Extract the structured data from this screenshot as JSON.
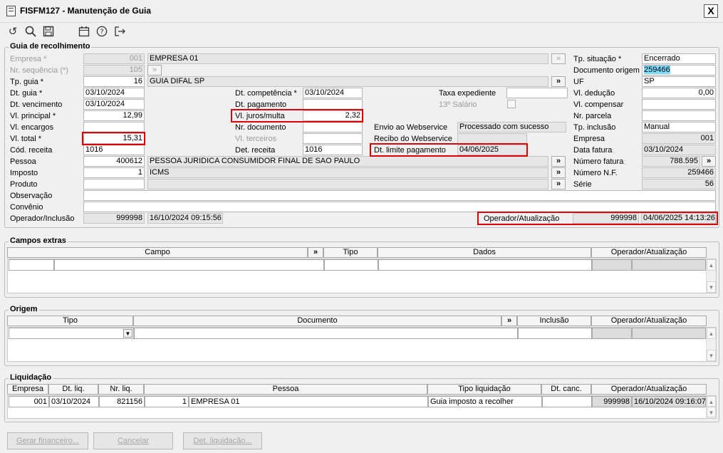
{
  "window": {
    "title": "FISFM127 - Manutenção de Guia",
    "close": "X"
  },
  "toolbar": {
    "icons": [
      "undo-icon",
      "search-icon",
      "save-icon",
      "calendar-icon",
      "help-icon",
      "exit-icon"
    ]
  },
  "guia": {
    "legend": "Guia de recolhimento",
    "empresa": {
      "label": "Empresa *",
      "code": "001",
      "name": "EMPRESA 01"
    },
    "nr_sequencia": {
      "label": "Nr. sequência (*)",
      "value": "105"
    },
    "tp_guia": {
      "label": "Tp. guia *",
      "code": "16",
      "name": "GUIA DIFAL SP"
    },
    "dt_guia": {
      "label": "Dt. guia *",
      "value": "03/10/2024"
    },
    "dt_vencimento": {
      "label": "Dt. vencimento",
      "value": "03/10/2024"
    },
    "vl_principal": {
      "label": "Vl. principal *",
      "value": "12,99"
    },
    "vl_encargos": {
      "label": "Vl. encargos",
      "value": ""
    },
    "vl_total": {
      "label": "Vl. total *",
      "value": "15,31"
    },
    "cod_receita": {
      "label": "Cód. receita",
      "value": "1016"
    },
    "pessoa": {
      "label": "Pessoa",
      "code": "400612",
      "name": "PESSOA JURIDICA CONSUMIDOR FINAL DE SAO PAULO"
    },
    "imposto": {
      "label": "Imposto",
      "code": "1",
      "name": "ICMS"
    },
    "produto": {
      "label": "Produto",
      "value": ""
    },
    "observacao": {
      "label": "Observação",
      "value": ""
    },
    "convenio": {
      "label": "Convênio",
      "value": ""
    },
    "operador_inclusao": {
      "label": "Operador/Inclusão",
      "code": "999998",
      "datetime": "16/10/2024 09:15:56"
    },
    "dt_competencia": {
      "label": "Dt. competência *",
      "value": "03/10/2024"
    },
    "dt_pagamento": {
      "label": "Dt. pagamento",
      "value": ""
    },
    "vl_juros": {
      "label": "Vl. juros/multa",
      "value": "2,32"
    },
    "nr_documento": {
      "label": "Nr. documento",
      "value": ""
    },
    "vl_terceiros": {
      "label": "Vl. terceiros",
      "value": ""
    },
    "det_receita": {
      "label": "Det. receita",
      "value": "1016"
    },
    "taxa_expediente": {
      "label": "Taxa expediente",
      "value": ""
    },
    "decimo_terceiro": {
      "label": "13º Salário"
    },
    "envio_webservice": {
      "label": "Envio ao Webservice",
      "value": "Processado com sucesso"
    },
    "recibo_webservice": {
      "label": "Recibo do Webservice",
      "value": ""
    },
    "dt_limite": {
      "label": "Dt. limite pagamento",
      "value": "04/06/2025"
    },
    "tp_situacao": {
      "label": "Tp. situação *",
      "value": "Encerrado"
    },
    "documento_origem": {
      "label": "Documento origem",
      "value": "259466"
    },
    "uf": {
      "label": "UF",
      "value": "SP"
    },
    "vl_deducao": {
      "label": "Vl. dedução",
      "value": "0,00"
    },
    "vl_compensar": {
      "label": "Vl. compensar",
      "value": ""
    },
    "nr_parcela": {
      "label": "Nr. parcela",
      "value": ""
    },
    "tp_inclusao": {
      "label": "Tp. inclusão",
      "value": "Manual"
    },
    "empresa_dir": {
      "label": "Empresa",
      "value": "001"
    },
    "data_fatura": {
      "label": "Data fatura",
      "value": "03/10/2024"
    },
    "numero_fatura": {
      "label": "Número fatura",
      "value": "788.595"
    },
    "numero_nf": {
      "label": "Número N.F.",
      "value": "259466"
    },
    "serie": {
      "label": "Série",
      "value": "56"
    },
    "operador_atualizacao": {
      "label": "Operador/Atualização",
      "code": "999998",
      "datetime": "04/06/2025 14:13:26"
    }
  },
  "campos_extras": {
    "legend": "Campos extras",
    "headers": [
      "Campo",
      "»",
      "Tipo",
      "Dados",
      "Operador/Atualização"
    ]
  },
  "origem": {
    "legend": "Origem",
    "headers": [
      "Tipo",
      "Documento",
      "»",
      "Inclusão",
      "Operador/Atualização"
    ]
  },
  "liquidacao": {
    "legend": "Liquidação",
    "headers": [
      "Empresa",
      "Dt. liq.",
      "Nr. liq.",
      "Pessoa",
      "Tipo liquidação",
      "Dt. canc.",
      "Operador/Atualização"
    ],
    "row": {
      "empresa": "001",
      "dt_liq": "03/10/2024",
      "nr_liq": "821156",
      "pessoa_code": "1",
      "pessoa_name": "EMPRESA 01",
      "tipo": "Guia imposto a recolher",
      "dt_canc": "",
      "operador": "999998",
      "atualizacao": "16/10/2024 09:16:07"
    }
  },
  "buttons": {
    "gerar": "Gerar financeiro...",
    "cancelar": "Cancelar",
    "det_liq": "Det. liquidação..."
  },
  "colors": {
    "highlight": "#e00000",
    "selection": "#7fdcff",
    "readonly": "#e6e6e6"
  }
}
